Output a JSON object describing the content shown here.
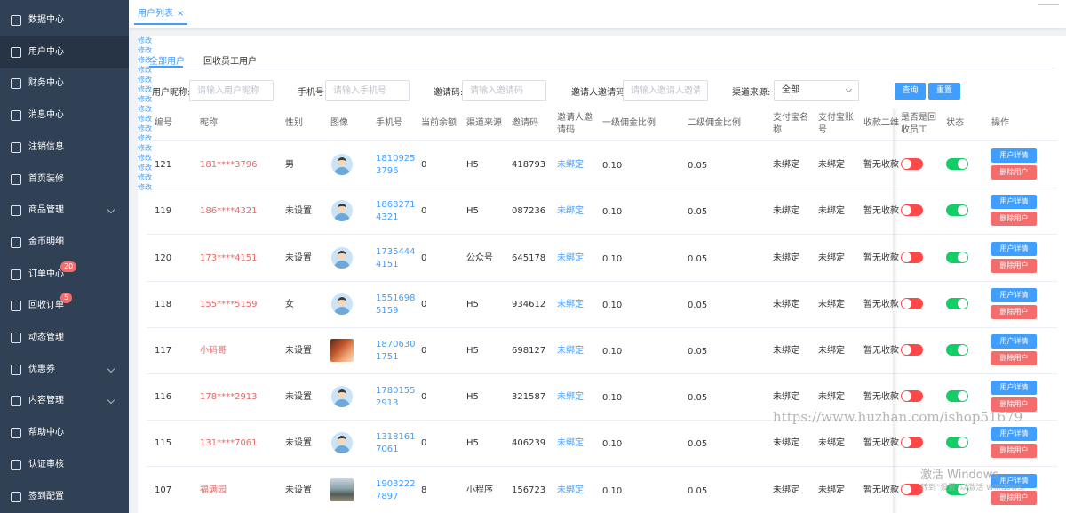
{
  "sidebar": {
    "items": [
      {
        "label": "数据中心",
        "icon": "chart-icon"
      },
      {
        "label": "用户中心",
        "icon": "user-icon",
        "active": true
      },
      {
        "label": "财务中心",
        "icon": "wallet-icon"
      },
      {
        "label": "消息中心",
        "icon": "message-icon"
      },
      {
        "label": "注销信息",
        "icon": "clipboard-icon"
      },
      {
        "label": "首页装修",
        "icon": "box-icon"
      },
      {
        "label": "商品管理",
        "icon": "layers-icon",
        "has_arrow": true
      },
      {
        "label": "金币明细",
        "icon": "clipboard-icon"
      },
      {
        "label": "订单中心",
        "icon": "clipboard-icon",
        "badge": "20"
      },
      {
        "label": "回收订单",
        "icon": "list-icon",
        "badge": "5"
      },
      {
        "label": "动态管理",
        "icon": "refresh-icon"
      },
      {
        "label": "优惠券",
        "icon": "coupon-icon",
        "has_arrow": true
      },
      {
        "label": "内容管理",
        "icon": "stack-icon",
        "has_arrow": true
      },
      {
        "label": "帮助中心",
        "icon": "message-icon"
      },
      {
        "label": "认证审核",
        "icon": "user-icon"
      },
      {
        "label": "签到配置",
        "icon": "clock-icon"
      }
    ]
  },
  "tabbar": {
    "active_tab": "用户列表",
    "close": "×"
  },
  "subtabs": {
    "all_users": "全部用户",
    "recycler_users": "回收员工用户"
  },
  "filters": {
    "nickname_label": "用户昵称:",
    "nickname_placeholder": "请输入用户昵称",
    "phone_label": "手机号:",
    "phone_placeholder": "请输入手机号",
    "invite_label": "邀请码:",
    "invite_placeholder": "请输入邀请码",
    "inviter_label": "邀请人邀请码:",
    "inviter_placeholder": "请输入邀请人邀请码",
    "channel_label": "渠道来源:",
    "channel_value": "全部",
    "search_button": "查询",
    "reset_button": "重置"
  },
  "table": {
    "headers": {
      "id": "编号",
      "nickname": "昵称",
      "gender": "性别",
      "avatar": "图像",
      "phone": "手机号",
      "balance": "当前余额",
      "channel": "渠道来源",
      "invite_code": "邀请码",
      "inviter_line1": "邀请人邀",
      "inviter_line2": "请码",
      "rate1": "一级佣金比例",
      "rate2": "二级佣金比例",
      "alipay_name_line1": "支付宝名",
      "alipay_name_line2": "称",
      "alipay_acct_line1": "支付宝账",
      "alipay_acct_line2": "号",
      "qr": "收款二维",
      "recycler_line1": "是否是回",
      "recycler_line2": "收员工",
      "status": "状态",
      "actions": "操作"
    },
    "edit_label": "修改",
    "detail_button": "用户详情",
    "delete_button": "删除用户",
    "rows": [
      {
        "id": "121",
        "nickname": "181****3796",
        "gender": "男",
        "avatar": "default",
        "phone1": "1810925",
        "phone2": "3796",
        "balance": "0",
        "channel": "H5",
        "invite_code": "418793",
        "inviter": "未绑定",
        "rate1": "0.10",
        "rate2": "0.05",
        "alipay_name": "未绑定",
        "alipay_acct": "未绑定",
        "qr": "暂无收款",
        "recycler": false,
        "status": true
      },
      {
        "id": "119",
        "nickname": "186****4321",
        "gender": "未设置",
        "avatar": "default",
        "phone1": "1868271",
        "phone2": "4321",
        "balance": "0",
        "channel": "H5",
        "invite_code": "087236",
        "inviter": "未绑定",
        "rate1": "0.10",
        "rate2": "0.05",
        "alipay_name": "未绑定",
        "alipay_acct": "未绑定",
        "qr": "暂无收款",
        "recycler": false,
        "status": true
      },
      {
        "id": "120",
        "nickname": "173****4151",
        "gender": "未设置",
        "avatar": "default",
        "phone1": "1735444",
        "phone2": "4151",
        "balance": "0",
        "channel": "公众号",
        "invite_code": "645178",
        "inviter": "未绑定",
        "rate1": "0.10",
        "rate2": "0.05",
        "alipay_name": "未绑定",
        "alipay_acct": "未绑定",
        "qr": "暂无收款",
        "recycler": false,
        "status": true
      },
      {
        "id": "118",
        "nickname": "155****5159",
        "gender": "女",
        "avatar": "default",
        "phone1": "1551698",
        "phone2": "5159",
        "balance": "0",
        "channel": "H5",
        "invite_code": "934612",
        "inviter": "未绑定",
        "rate1": "0.10",
        "rate2": "0.05",
        "alipay_name": "未绑定",
        "alipay_acct": "未绑定",
        "qr": "暂无收款",
        "recycler": false,
        "status": true
      },
      {
        "id": "117",
        "nickname": "小码哥",
        "gender": "未设置",
        "avatar": "photo1",
        "phone1": "1870630",
        "phone2": "1751",
        "balance": "0",
        "channel": "H5",
        "invite_code": "698127",
        "inviter": "未绑定",
        "rate1": "0.10",
        "rate2": "0.05",
        "alipay_name": "未绑定",
        "alipay_acct": "未绑定",
        "qr": "暂无收款",
        "recycler": false,
        "status": true
      },
      {
        "id": "116",
        "nickname": "178****2913",
        "gender": "未设置",
        "avatar": "default",
        "phone1": "1780155",
        "phone2": "2913",
        "balance": "0",
        "channel": "H5",
        "invite_code": "321587",
        "inviter": "未绑定",
        "rate1": "0.10",
        "rate2": "0.05",
        "alipay_name": "未绑定",
        "alipay_acct": "未绑定",
        "qr": "暂无收款",
        "recycler": false,
        "status": true
      },
      {
        "id": "115",
        "nickname": "131****7061",
        "gender": "未设置",
        "avatar": "default",
        "phone1": "1318161",
        "phone2": "7061",
        "balance": "0",
        "channel": "H5",
        "invite_code": "406239",
        "inviter": "未绑定",
        "rate1": "0.10",
        "rate2": "0.05",
        "alipay_name": "未绑定",
        "alipay_acct": "未绑定",
        "qr": "暂无收款",
        "recycler": false,
        "status": true
      },
      {
        "id": "107",
        "nickname": "福满园",
        "gender": "未设置",
        "avatar": "photo2",
        "phone1": "1903222",
        "phone2": "7897",
        "balance": "8",
        "channel": "小程序",
        "invite_code": "156723",
        "inviter": "未绑定",
        "rate1": "0.10",
        "rate2": "0.05",
        "alipay_name": "未绑定",
        "alipay_acct": "未绑定",
        "qr": "暂无收款",
        "recycler": false,
        "status": true
      }
    ]
  },
  "overlays": {
    "watermark_url": "https://www.huzhan.com/ishop51679",
    "windows_line1": "激活 Windows",
    "windows_line2": "转到\"设置\"以激活 Windows。"
  },
  "colors": {
    "sidebar_bg": "#304156",
    "sidebar_active_bg": "#263445",
    "primary": "#409eff",
    "danger": "#f56c6c",
    "switch_off": "#ff4949",
    "switch_on": "#13ce66",
    "nickname_link": "#e46b6b",
    "badge": "#f56c6c"
  }
}
